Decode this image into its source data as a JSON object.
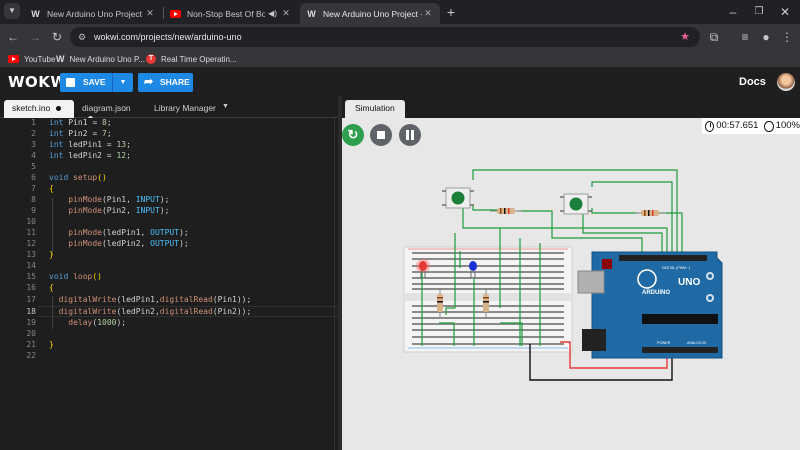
{
  "browser": {
    "tabs": [
      {
        "title": "New Arduino Uno Project - Wo",
        "icon": "wokwi-favicon",
        "active": false
      },
      {
        "title": "Non-Stop Best Of Bollywood",
        "icon": "youtube-favicon",
        "active": false
      },
      {
        "title": "New Arduino Uno Project - Wo",
        "icon": "wokwi-favicon",
        "active": true
      }
    ],
    "url": "wokwi.com/projects/new/arduino-uno",
    "bookmarks": [
      {
        "label": "YouTube",
        "icon": "youtube-favicon"
      },
      {
        "label": "New Arduino Uno P...",
        "icon": "wokwi-favicon"
      },
      {
        "label": "Real Time Operatin...",
        "icon": "t-favicon"
      }
    ]
  },
  "app": {
    "logo": "WOKWI",
    "save_label": "SAVE",
    "share_label": "SHARE",
    "docs_label": "Docs"
  },
  "editor": {
    "tabs": [
      "sketch.ino",
      "diagram.json",
      "Library Manager"
    ],
    "lines": [
      "int Pin1 = 8;",
      "int Pin2 = 7;",
      "int ledPin1 = 13;",
      "int ledPin2 = 12;",
      "",
      "void setup()",
      "{",
      "    pinMode(Pin1, INPUT);",
      "    pinMode(Pin2, INPUT);",
      "",
      "    pinMode(ledPin1, OUTPUT);",
      "    pinMode(ledPin2, OUTPUT);",
      "}",
      "",
      "void loop()",
      "{",
      "  digitalWrite(ledPin1,digitalRead(Pin1));",
      "  digitalWrite(ledPin2,digitalRead(Pin2));",
      "    delay(1000);",
      "",
      "}",
      ""
    ]
  },
  "simulation": {
    "tab_label": "Simulation",
    "timer": "00:57.651",
    "speed": "100%",
    "board_labels": {
      "brand": "ARDUINO",
      "model": "UNO",
      "digital": "DIGITAL (PWM ~)",
      "analog": "ANALOG IN",
      "power": "POWER"
    }
  },
  "colors": {
    "accent": "#1e88e5",
    "restart": "#2e9e4f",
    "board": "#1f6aa5",
    "wire_green": "#1d9b3c",
    "wire_red": "#e53935",
    "wire_black": "#111111"
  }
}
